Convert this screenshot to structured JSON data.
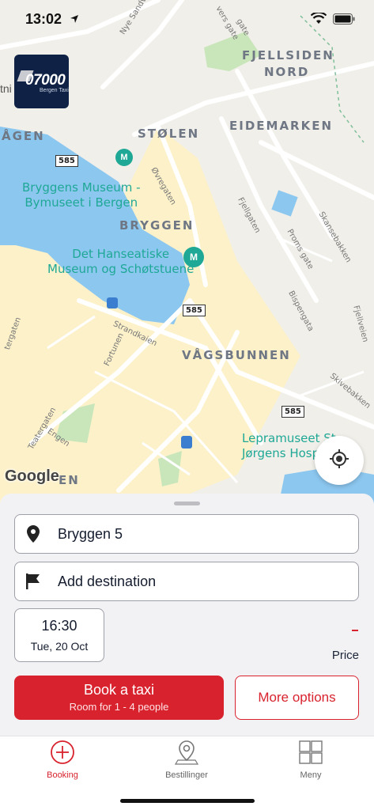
{
  "status": {
    "time": "13:02"
  },
  "logo": {
    "number": "07000",
    "subtitle": "Bergen Taxi"
  },
  "map": {
    "left_edge_text": "tni",
    "districts": {
      "fjellsiden_line1": "FJELLSIDEN",
      "fjellsiden_line2": "NORD",
      "eidemarken": "EIDEMARKEN",
      "stolen": "STØLEN",
      "agen": "ÅGEN",
      "bryggen": "BRYGGEN",
      "vagsbunnen": "VÅGSBUNNEN",
      "en": "EN"
    },
    "streets": {
      "nye_sandviksveien": "Nye Sandviksveien",
      "ovregaten": "Øvregaten",
      "strandkaien": "Strandkaien",
      "fortunen": "Fortunen",
      "teatergaten": "Teatergaten",
      "engen": "Engen",
      "fjellgaten": "Fjellgaten",
      "proms_gate": "Proms gate",
      "skansebakken": "Skansebakken",
      "bispengata": "Bispengata",
      "skivebakken": "Skivebakken",
      "tergaten": "tergaten",
      "gate1": "vers gate",
      "gate2": "gate",
      "fjellveien": "Fjellveien"
    },
    "road_shields": [
      "585",
      "585",
      "585"
    ],
    "pois": {
      "bryggens_line1": "Bryggens Museum -",
      "bryggens_line2": "Bymuseet i Bergen",
      "hanseatiske_line1": "Det Hanseatiske",
      "hanseatiske_line2": "Museum og Schøtstuene",
      "lepra_line1": "Lepramuseet St",
      "lepra_line2": "Jørgens Hospi"
    },
    "attribution": "Google"
  },
  "booking": {
    "pickup": "Bryggen 5",
    "destination_placeholder": "Add destination",
    "time": "16:30",
    "date": "Tue, 20 Oct",
    "price_label": "Price",
    "price_value": "–",
    "book_label": "Book a taxi",
    "book_sub": "Room for 1 - 4 people",
    "more_label": "More options"
  },
  "tabs": [
    {
      "label": "Booking",
      "icon": "plus-circle-icon",
      "active": true
    },
    {
      "label": "Bestillinger",
      "icon": "map-pin-icon",
      "active": false
    },
    {
      "label": "Meny",
      "icon": "grid-icon",
      "active": false
    }
  ],
  "colors": {
    "accent": "#d8232e",
    "navy": "#0f2246",
    "poi": "#1fa896",
    "water": "#8cc7f0",
    "old_town": "#fcf1c9"
  }
}
